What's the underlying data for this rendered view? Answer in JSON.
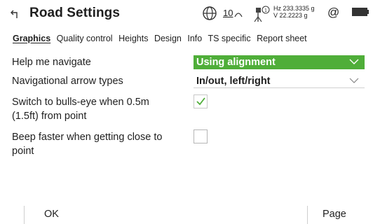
{
  "header": {
    "title": "Road Settings",
    "back_icon": "back-arrow-icon",
    "satellite_count": "10",
    "hz": "Hz 233.3335 g",
    "v": "V  22.2223 g",
    "status_icons": [
      "globe-icon",
      "satellite-icon",
      "prism-icon",
      "at-icon",
      "battery-icon"
    ]
  },
  "tabs": [
    {
      "label": "Graphics",
      "active": true
    },
    {
      "label": "Quality control"
    },
    {
      "label": "Heights"
    },
    {
      "label": "Design"
    },
    {
      "label": "Info"
    },
    {
      "label": "TS specific"
    },
    {
      "label": "Report sheet"
    }
  ],
  "settings": {
    "help_navigate": {
      "label": "Help me navigate",
      "value": "Using alignment"
    },
    "arrow_types": {
      "label": "Navigational arrow types",
      "value": "In/out, left/right"
    },
    "bullseye": {
      "label_line1": "Switch to bulls-eye when 0.5m",
      "label_line2": "(1.5ft) from point",
      "checked": true
    },
    "beep": {
      "label_line1": "Beep faster when getting close to",
      "label_line2": "point",
      "checked": false
    }
  },
  "softkeys": {
    "left": "OK",
    "right": "Page"
  },
  "colors": {
    "accent_green": "#4fae39"
  }
}
